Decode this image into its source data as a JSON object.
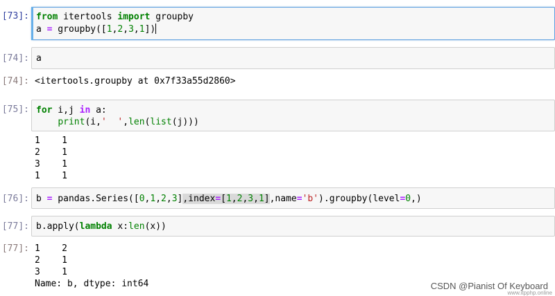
{
  "cells": [
    {
      "in_prompt": "[73]:",
      "lines": [
        "from itertools import groupby",
        "a = groupby([1,2,3,1])"
      ]
    },
    {
      "in_prompt": "[74]:",
      "lines": [
        "a"
      ],
      "out_prompt": "[74]:",
      "output": [
        "<itertools.groupby at 0x7f33a55d2860>"
      ]
    },
    {
      "in_prompt": "[75]:",
      "lines": [
        "for i,j in a:",
        "    print(i,'  ',len(list(j)))"
      ],
      "output": [
        "1    1",
        "2    1",
        "3    1",
        "1    1"
      ]
    },
    {
      "in_prompt": "[76]:",
      "lines": [
        "b = pandas.Series([0,1,2,3],index=[1,2,3,1],name='b').groupby(level=0,)"
      ]
    },
    {
      "in_prompt": "[77]:",
      "lines": [
        "b.apply(lambda x:len(x))"
      ],
      "out_prompt": "[77]:",
      "output": [
        "1    2",
        "2    1",
        "3    1",
        "Name: b, dtype: int64"
      ]
    }
  ],
  "watermark": "CSDN @Pianist Of Keyboard",
  "watermark_url": "www.itpphp.online",
  "colors": {
    "in_prompt": "#303f9f",
    "out_prompt": "#c04545",
    "keyword": "#008000",
    "active_border": "#5a9de0"
  }
}
